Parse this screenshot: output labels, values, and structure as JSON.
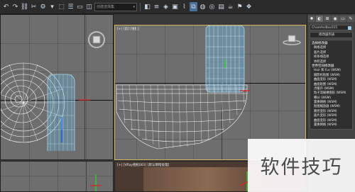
{
  "toolbar": {
    "buttons_left": [
      {
        "icon": "undo-icon",
        "glyph": "↶"
      },
      {
        "icon": "redo-icon",
        "glyph": "↷"
      },
      {
        "icon": "link-icon",
        "glyph": "⛓"
      },
      {
        "icon": "unlink-icon",
        "glyph": "✂"
      },
      {
        "icon": "bind-icon",
        "glyph": "⚙"
      },
      {
        "icon": "filter-icon",
        "glyph": "▾"
      },
      {
        "icon": "select-icon",
        "glyph": "⬚"
      },
      {
        "icon": "select-by-name-icon",
        "glyph": "☰"
      },
      {
        "icon": "rect-select-icon",
        "glyph": "▭"
      },
      {
        "icon": "window-crossing-icon",
        "glyph": "◫"
      }
    ],
    "selection_set_placeholder": "创建选择集",
    "buttons_right": [
      {
        "icon": "mirror-icon",
        "glyph": "◧",
        "active": false
      },
      {
        "icon": "align-icon",
        "glyph": "≡",
        "active": false
      },
      {
        "icon": "layers-icon",
        "glyph": "◈",
        "active": false
      },
      {
        "icon": "scene-explorer-icon",
        "glyph": "▣",
        "active": false
      },
      {
        "icon": "curve-editor-icon",
        "glyph": "⌇",
        "active": false
      },
      {
        "icon": "schematic-icon",
        "glyph": "⧉",
        "active": true
      },
      {
        "icon": "material-editor-icon",
        "glyph": "◍",
        "active": false
      },
      {
        "icon": "render-setup-icon",
        "glyph": "◎",
        "active": false
      },
      {
        "icon": "rendered-frame-icon",
        "glyph": "▤",
        "active": false
      },
      {
        "icon": "render-icon",
        "glyph": "☕",
        "active": false
      },
      {
        "icon": "render-production-icon",
        "glyph": "⚑",
        "active": false
      },
      {
        "icon": "render-active-icon",
        "glyph": "❖",
        "active": false
      }
    ]
  },
  "viewports": {
    "top_right_label": "[+] [前] [线框]",
    "bottom_left_label": "",
    "bottom_mid_label": "[+] [VRay相机001] [默认明暗处理]",
    "bottom_right_label": ""
  },
  "command_panel": {
    "tabs": [
      {
        "icon": "create-icon",
        "glyph": "✹"
      },
      {
        "icon": "modify-icon",
        "glyph": "◐"
      },
      {
        "icon": "hierarchy-icon",
        "glyph": "⊞"
      },
      {
        "icon": "motion-icon",
        "glyph": "◉"
      },
      {
        "icon": "display-icon",
        "glyph": "▭"
      },
      {
        "icon": "utilities-icon",
        "glyph": "✎"
      }
    ],
    "object_name": "ChamferBox015",
    "modifier_list_label": "修改器列表",
    "modifier_section_title": "选择修改器",
    "modifiers_a": [
      "网格选择",
      "面片选择",
      "样条线选择",
      "体积选择"
    ],
    "modifier_section_title_b": "世界空间修改器",
    "modifiers_b": [
      "Hair 和 Fur (WSM)",
      "摄影机贴图 (WSM)",
      "曲面变形 (WSM)",
      "曲面贴图 (WSM)",
      "点缓存 (WSM)",
      "粒子流碰撞图形 (WSM)",
      "细分 (WSM)",
      "置换网格 (WSM)",
      "贴图缩放器 (WSM)",
      "路径变形 (WSM)",
      "面片变形 (WSM)",
      "曲面变形 (WSM)",
      "置换网格 (WSM)"
    ]
  },
  "watermark": "软件技巧",
  "colors": {
    "wire_white": "#ffffff",
    "wire_selected": "#a8d8f0",
    "selected_fill": "#6fb6de",
    "active_border": "#d2b25a",
    "viewport_bg": "#6e6e6e"
  }
}
